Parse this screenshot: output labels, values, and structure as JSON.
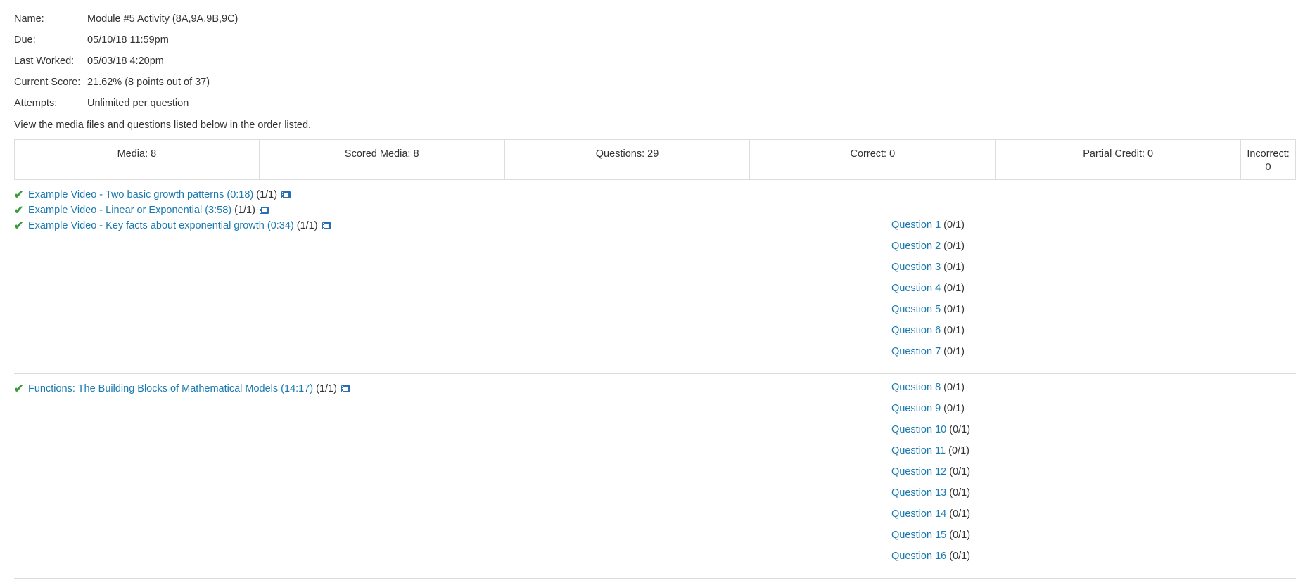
{
  "info": {
    "rows": [
      {
        "label": "Name:",
        "value": "Module #5 Activity (8A,9A,9B,9C)"
      },
      {
        "label": "Due:",
        "value": "05/10/18 11:59pm"
      },
      {
        "label": "Last Worked:",
        "value": "05/03/18 4:20pm"
      },
      {
        "label": "Current Score:",
        "value": "21.62% (8 points out of 37)"
      },
      {
        "label": "Attempts:",
        "value": "Unlimited per question"
      }
    ],
    "instructions": "View the media files and questions listed below in the order listed."
  },
  "summary": {
    "media": "Media: 8",
    "scored_media": "Scored Media: 8",
    "questions": "Questions: 29",
    "correct": "Correct: 0",
    "partial": "Partial Credit: 0",
    "incorrect_label": "Incorrect:",
    "incorrect_value": "0"
  },
  "media": [
    {
      "title": "Example Video - Two basic growth patterns (0:18)",
      "score": "(1/1)",
      "icon": "film-icon"
    },
    {
      "title": "Example Video - Linear or Exponential (3:58)",
      "score": "(1/1)",
      "icon": "film-icon"
    },
    {
      "title": "Example Video - Key facts about exponential growth (0:34)",
      "score": "(1/1)",
      "icon": "film-icon"
    },
    {
      "title": "Functions: The Building Blocks of Mathematical Models (14:17)",
      "score": "(1/1)",
      "icon": "film-icon"
    }
  ],
  "check_glyph": "✔",
  "questions": [
    {
      "label": "Question 1",
      "score": "(0/1)"
    },
    {
      "label": "Question 2",
      "score": "(0/1)"
    },
    {
      "label": "Question 3",
      "score": "(0/1)"
    },
    {
      "label": "Question 4",
      "score": "(0/1)"
    },
    {
      "label": "Question 5",
      "score": "(0/1)"
    },
    {
      "label": "Question 6",
      "score": "(0/1)"
    },
    {
      "label": "Question 7",
      "score": "(0/1)"
    },
    {
      "label": "Question 8",
      "score": "(0/1)"
    },
    {
      "label": "Question 9",
      "score": "(0/1)"
    },
    {
      "label": "Question 10",
      "score": "(0/1)"
    },
    {
      "label": "Question 11",
      "score": "(0/1)"
    },
    {
      "label": "Question 12",
      "score": "(0/1)"
    },
    {
      "label": "Question 13",
      "score": "(0/1)"
    },
    {
      "label": "Question 14",
      "score": "(0/1)"
    },
    {
      "label": "Question 15",
      "score": "(0/1)"
    },
    {
      "label": "Question 16",
      "score": "(0/1)"
    }
  ],
  "colors": {
    "link": "#1a7ab0",
    "check": "#3c9a3c",
    "film": "#2a6fb0"
  }
}
